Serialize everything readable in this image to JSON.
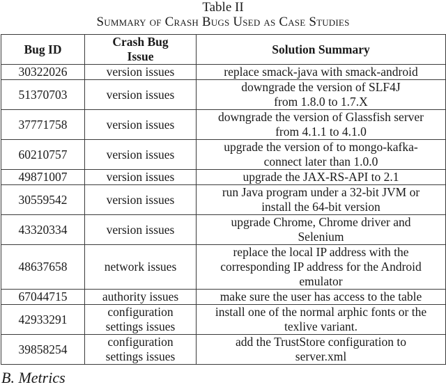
{
  "table": {
    "label": "Table II",
    "caption": "Summary of Crash Bugs Used as Case Studies",
    "headers": [
      "Bug ID",
      "Crash Bug Issue",
      "Solution Summary"
    ],
    "rows": [
      {
        "bug_id": "30322026",
        "issue": "version issues",
        "solution": "replace smack-java with smack-android"
      },
      {
        "bug_id": "51370703",
        "issue": "version issues",
        "solution": "downgrade the version of SLF4J from 1.8.0 to 1.7.X"
      },
      {
        "bug_id": "37771758",
        "issue": "version issues",
        "solution": "downgrade the version of Glassfish server from 4.1.1 to 4.1.0"
      },
      {
        "bug_id": "60210757",
        "issue": "version issues",
        "solution": "upgrade the version of to mongo-kafka-connect later than 1.0.0"
      },
      {
        "bug_id": "49871007",
        "issue": "version issues",
        "solution": "upgrade the JAX-RS-API to 2.1"
      },
      {
        "bug_id": "30559542",
        "issue": "version issues",
        "solution": "run Java program under a 32-bit JVM or install the 64-bit version"
      },
      {
        "bug_id": "43320334",
        "issue": "version issues",
        "solution": "upgrade Chrome, Chrome driver and Selenium"
      },
      {
        "bug_id": "48637658",
        "issue": "network issues",
        "solution": "replace the local IP address with the corresponding IP address for the Android emulator"
      },
      {
        "bug_id": "67044715",
        "issue": "authority issues",
        "solution": "make sure the user has access to the table"
      },
      {
        "bug_id": "42933291",
        "issue": "configuration settings issues",
        "solution": "install one of the normal arphic fonts or the texlive variant."
      },
      {
        "bug_id": "39858254",
        "issue": "configuration settings issues",
        "solution": "add the TrustStore configuration to server.xml"
      }
    ]
  },
  "next_section": {
    "heading": "B.  Metrics"
  }
}
